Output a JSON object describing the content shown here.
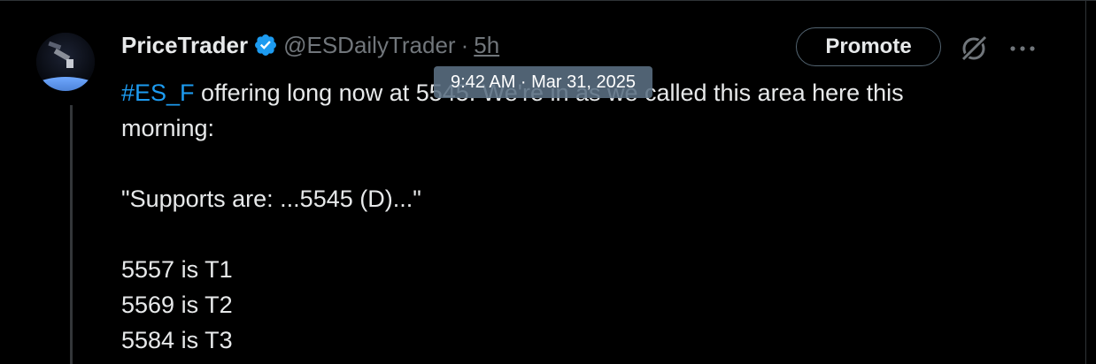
{
  "author": {
    "display_name": "PriceTrader",
    "handle": "@ESDailyTrader",
    "separator": "·",
    "time_ago": "5h",
    "verified_color": "#1d9bf0"
  },
  "actions": {
    "promote_label": "Promote",
    "grok_icon": "grok-icon",
    "more_icon": "more-icon"
  },
  "tooltip": {
    "text": "9:42 AM · Mar 31, 2025"
  },
  "post": {
    "hashtag": "#ES_F",
    "line1_rest": " offering long now at 5545. We're in as we called this area here this",
    "line2": "morning:",
    "line3": "",
    "line4": "\"Supports are: ...5545 (D)...\"",
    "line5": "",
    "line6": "5557 is T1",
    "line7": "5569 is T2",
    "line8": "5584 is T3"
  },
  "colors": {
    "background": "#000000",
    "text": "#e7e9ea",
    "muted": "#71767b",
    "link": "#1d9bf0",
    "border": "#2f3336"
  }
}
